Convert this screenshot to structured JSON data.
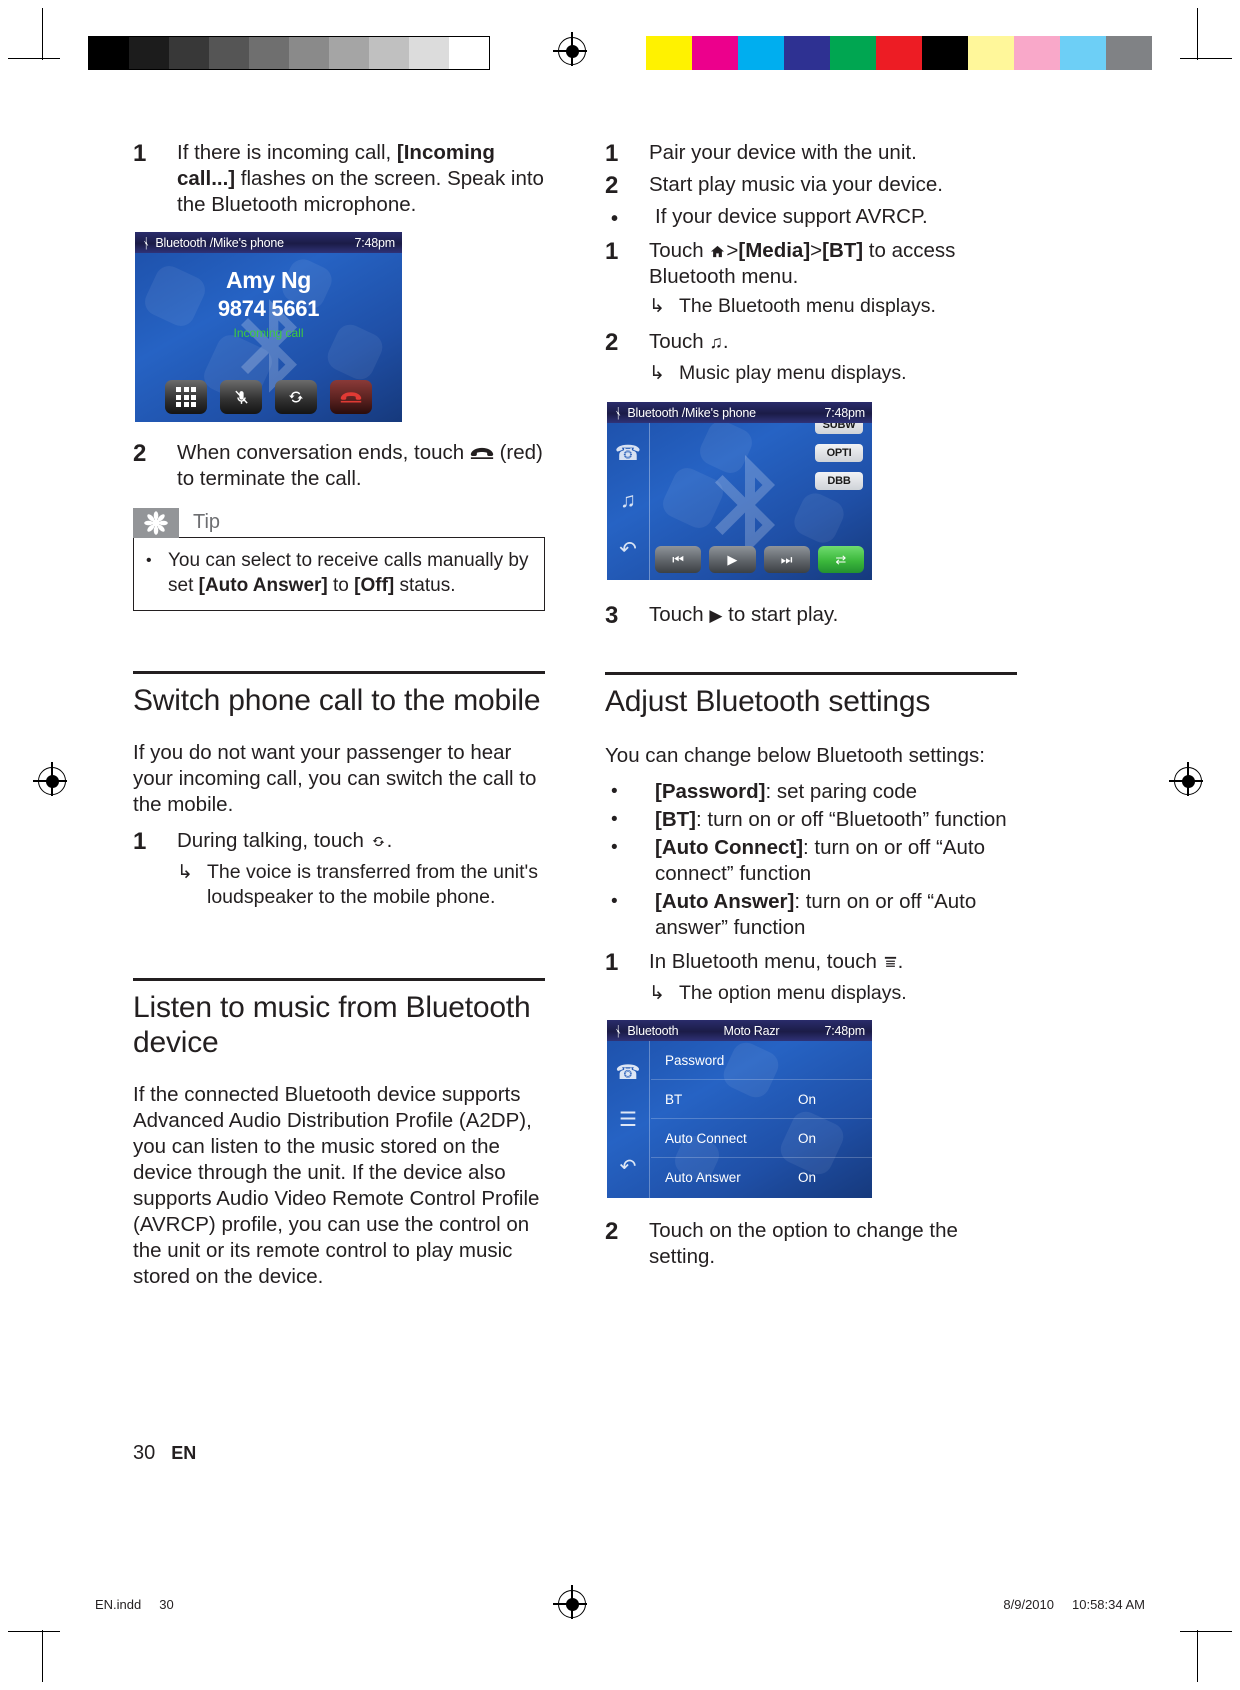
{
  "page": {
    "folio_number": "30",
    "folio_lang": "EN",
    "footer_file": "EN.indd",
    "footer_page": "30",
    "footer_date": "8/9/2010",
    "footer_time": "10:58:34 AM"
  },
  "calibration": {
    "greyscale_swatches": [
      "#000000",
      "#1c1c1c",
      "#383838",
      "#555555",
      "#6f6f6f",
      "#8a8a8a",
      "#a5a5a5",
      "#c0c0c0",
      "#dcdcdc",
      "#ffffff"
    ],
    "color_swatches": [
      "#fff200",
      "#ec008c",
      "#00aeef",
      "#2e3192",
      "#00a651",
      "#ed1c24",
      "#000000",
      "#fff79a",
      "#f9a8c9",
      "#6dcff6",
      "#808285"
    ]
  },
  "left_column": {
    "step1": {
      "num": "1",
      "text_a": "If there is incoming call, ",
      "text_b": "[Incoming call...]",
      "text_c": " flashes on the screen. Speak into the Bluetooth microphone."
    },
    "call_screen": {
      "statusbar_title": "Bluetooth /Mike's phone",
      "statusbar_clock": "7:48pm",
      "caller_name": "Amy Ng",
      "caller_number": "9874 5661",
      "call_state": "Incoming call",
      "state_color": "#3fcb3f",
      "buttons": [
        {
          "name": "keypad-icon",
          "glyph": ""
        },
        {
          "name": "mute-microphone-icon",
          "glyph": "Ø"
        },
        {
          "name": "transfer-call-icon",
          "glyph": "↻"
        },
        {
          "name": "end-call-icon",
          "glyph": "☎"
        }
      ]
    },
    "step2": {
      "num": "2",
      "text_a": "When conversation ends, touch ",
      "icon": "end-call",
      "text_b": " (red) to terminate the call."
    },
    "tip": {
      "label": "Tip",
      "bullet": "•",
      "text_a": "You can select to receive calls manually by set ",
      "text_b": "[Auto Answer]",
      "text_c": " to ",
      "text_d": "[Off]",
      "text_e": " status."
    },
    "section_switch": {
      "heading": "Switch phone call to the mobile",
      "para": "If you do not want your passenger to hear your incoming call, you can switch the call to the mobile.",
      "step1_num": "1",
      "step1_text_a": "During talking, touch ",
      "step1_icon": "transfer-call",
      "step1_text_b": ".",
      "result_arrow": "↳",
      "result_text": "The voice is transferred from the unit's loudspeaker to the mobile phone."
    },
    "section_listen": {
      "heading": "Listen to music from Bluetooth device",
      "para": "If the connected Bluetooth device supports Advanced Audio Distribution Profile (A2DP), you can listen to the music stored on the device through the unit. If the device also supports Audio Video Remote Control Profile (AVRCP) profile, you can use the control on the unit or its remote control to play music stored on the device."
    }
  },
  "right_column": {
    "steps_top": [
      {
        "num": "1",
        "text": "Pair your device with the unit."
      },
      {
        "num": "2",
        "text": "Start play music via your device."
      },
      {
        "num": "•",
        "text": "If your device support AVRCP."
      }
    ],
    "step_media": {
      "num": "1",
      "text_a": "Touch ",
      "icon": "home",
      "text_b": ">",
      "bold_1": "[Media]",
      "text_c": ">",
      "bold_2": "[BT]",
      "text_d": " to access Bluetooth menu.",
      "result_arrow": "↳",
      "result_text": "The Bluetooth menu displays."
    },
    "step_music": {
      "num": "2",
      "text_a": "Touch ",
      "icon": "music-note",
      "text_b": ".",
      "result_arrow": "↳",
      "result_text": "Music play menu displays."
    },
    "music_screen": {
      "statusbar_title": "Bluetooth /Mike's phone",
      "statusbar_clock": "7:48pm",
      "rail_icons": [
        "phone-icon",
        "music-note-icon",
        "back-arrow-icon"
      ],
      "sound_buttons": [
        "SUBW",
        "OPTI",
        "DBB"
      ],
      "transport_buttons": [
        {
          "name": "previous-track-icon",
          "glyph": "⏮"
        },
        {
          "name": "play-icon",
          "glyph": "▶"
        },
        {
          "name": "next-track-icon",
          "glyph": "⏭"
        },
        {
          "name": "shuffle-icon",
          "glyph": "⇄"
        }
      ]
    },
    "step_play": {
      "num": "3",
      "text_a": "Touch ",
      "icon": "play",
      "text_b": " to start play."
    },
    "section_adjust": {
      "heading": "Adjust Bluetooth settings",
      "para": "You can change below Bluetooth settings:",
      "options": [
        {
          "bullet": "•",
          "bold": "[Password]",
          "rest": ": set paring code"
        },
        {
          "bullet": "•",
          "bold": "[BT]",
          "rest": ": turn on or off “Bluetooth” function"
        },
        {
          "bullet": "•",
          "bold": "[Auto Connect]",
          "rest": ": turn on or off “Auto connect” function"
        },
        {
          "bullet": "•",
          "bold": "[Auto Answer]",
          "rest": ": turn on or off “Auto answer” function"
        }
      ],
      "step1_num": "1",
      "step1_text_a": "In Bluetooth menu, touch ",
      "step1_icon": "list-menu",
      "step1_text_b": ".",
      "result_arrow": "↳",
      "result_text": "The option menu displays.",
      "step2_num": "2",
      "step2_text": "Touch on the option to change the setting."
    },
    "settings_screen": {
      "statusbar_title": "Bluetooth",
      "statusbar_device": "Moto Razr",
      "statusbar_clock": "7:48pm",
      "rail_icons": [
        "phone-icon",
        "list-menu-icon",
        "back-arrow-icon"
      ],
      "rows": [
        {
          "label": "Password",
          "value": ""
        },
        {
          "label": "BT",
          "value": "On"
        },
        {
          "label": "Auto Connect",
          "value": "On"
        },
        {
          "label": "Auto Answer",
          "value": "On"
        }
      ]
    }
  }
}
